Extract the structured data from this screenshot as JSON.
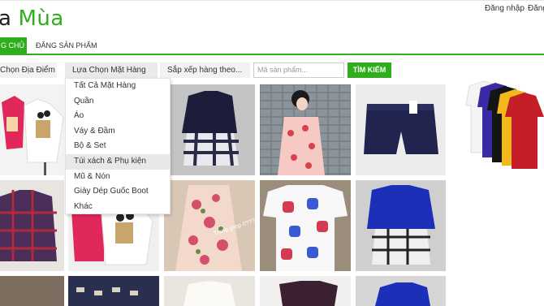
{
  "header": {
    "logo_part1": "a",
    "logo_part2": "Mùa",
    "login": "Đăng nhập",
    "register": "Đăng"
  },
  "nav": {
    "home": "G CHỦ",
    "post_product": "ĐĂNG SẢN PHẨM"
  },
  "filters": {
    "location": "Chọn Địa Điểm",
    "category": "Lựa Chọn Mặt Hàng",
    "sort": "Sắp xếp hàng theo...",
    "code_placeholder": "Mã sản phẩm...",
    "search_button": "TÌM KIẾM"
  },
  "category_menu": {
    "items": [
      "Tất Cả Mặt Hàng",
      "Quần",
      "Áo",
      "Váy & Đầm",
      "Bộ & Set",
      "Túi xách & Phụ kiện",
      "Mũ & Nón",
      "Giày Dép Guốc Boot",
      "Khác"
    ],
    "highlighted": "Túi xách & Phụ kiện"
  },
  "product_images": {
    "watermark": "Trang ghop 0?????78688"
  }
}
